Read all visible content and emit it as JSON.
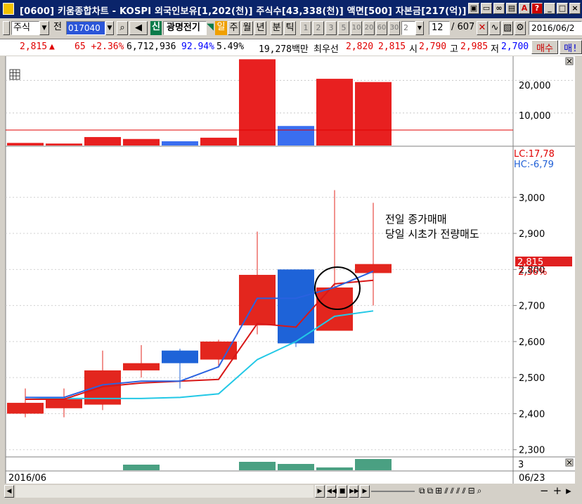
{
  "window": {
    "title": "[0600] 키움종합차트 - KOSPI 외국인보유[1,202(천)] 주식수[43,338(천)] 액면[500] 자본금[217(억)]",
    "min_label": "_",
    "max_label": "□",
    "close_label": "×"
  },
  "toolbar": {
    "market_label": "주식",
    "prev_label": "전",
    "code_value": "017040",
    "new_badge": "신",
    "stock_name": "광명전기",
    "period_active": "일",
    "periods": [
      "주",
      "월",
      "년",
      "분",
      "틱"
    ],
    "intervals": [
      "1",
      "2",
      "3",
      "5",
      "10",
      "20",
      "60",
      "30",
      "2"
    ],
    "count_value": "12",
    "total_count": "/ 607",
    "date_value": "2016/06/2"
  },
  "quote": {
    "price": "2,815",
    "arrow": "▲",
    "change": "65 +2.36%",
    "volume": "6,712,936",
    "ratio": "92.94%",
    "turnover": "5.49%",
    "amount": "19,278백만",
    "best_ask_label": "최우선",
    "best_ask": "2,820",
    "best_bid": "2,815",
    "open_label": "시",
    "open": "2,790",
    "high_label": "고",
    "high": "2,985",
    "low_label": "저",
    "low": "2,700",
    "buy_button": "매수",
    "sell_button": "매!"
  },
  "chart_data": {
    "type": "candlestick",
    "volume_axis_ticks": [
      "20,000",
      "10,000"
    ],
    "price_axis_ticks": [
      "3,000",
      "2,900",
      "2,800",
      "2,700",
      "2,600",
      "2,500",
      "2,400",
      "2,300"
    ],
    "lc_label": "LC:17,78",
    "hc_label": "HC:-6,79",
    "current_price_label": "2,815",
    "current_change_label": "2,36%",
    "lower_panel_tick": "3",
    "start_date": "2016/06",
    "end_date": "06/23",
    "annotation_line1": "전일 종가매매",
    "annotation_line2": "당일 시초가 전량매도",
    "y_range": [
      2280,
      3060
    ],
    "volume_range": [
      0,
      27000
    ],
    "candles": [
      {
        "open": 2400,
        "close": 2430,
        "high": 2470,
        "low": 2390,
        "volume": 800
      },
      {
        "open": 2415,
        "close": 2440,
        "high": 2470,
        "low": 2390,
        "volume": 600
      },
      {
        "open": 2425,
        "close": 2520,
        "high": 2575,
        "low": 2410,
        "volume": 2600
      },
      {
        "open": 2520,
        "close": 2540,
        "high": 2590,
        "low": 2500,
        "volume": 2000
      },
      {
        "open": 2575,
        "close": 2540,
        "high": 2580,
        "low": 2470,
        "volume": 1300
      },
      {
        "open": 2550,
        "close": 2600,
        "high": 2605,
        "low": 2530,
        "volume": 2400
      },
      {
        "open": 2645,
        "close": 2785,
        "high": 2905,
        "low": 2620,
        "volume": 26500
      },
      {
        "open": 2800,
        "close": 2595,
        "high": 2800,
        "low": 2585,
        "volume": 6000
      },
      {
        "open": 2630,
        "close": 2750,
        "high": 3020,
        "low": 2630,
        "volume": 20500
      },
      {
        "open": 2790,
        "close": 2815,
        "high": 2985,
        "low": 2700,
        "volume": 19500
      }
    ],
    "ma_blue": [
      2445,
      2445,
      2480,
      2490,
      2490,
      2530,
      2720,
      2720,
      2750,
      2795
    ],
    "ma_red": [
      2440,
      2440,
      2475,
      2485,
      2490,
      2495,
      2650,
      2640,
      2760,
      2770
    ],
    "ma_cyan": [
      2445,
      2442,
      2442,
      2442,
      2445,
      2455,
      2550,
      2600,
      2670,
      2685
    ]
  }
}
